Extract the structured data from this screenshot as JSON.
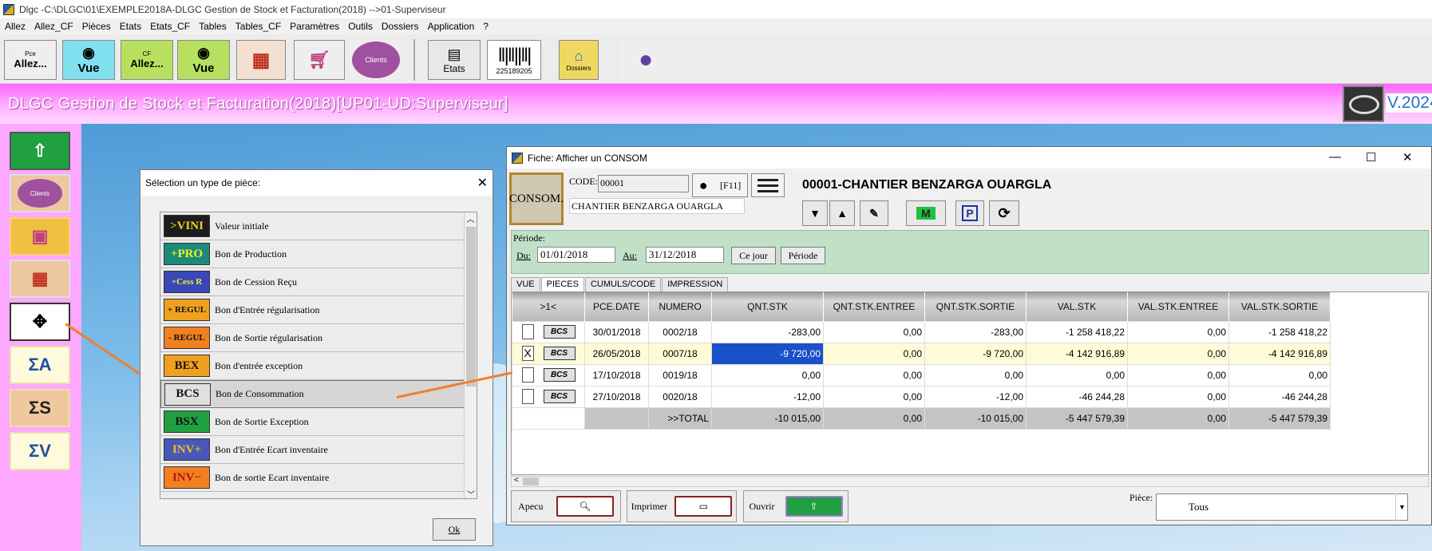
{
  "window": {
    "title": "Dlgc -C:\\DLGC\\01\\EXEMPLE2018A-DLGC Gestion de Stock et Facturation(2018) -->01-Superviseur"
  },
  "menu": [
    "Allez",
    "Allez_CF",
    "Pièces",
    "Etats",
    "Etats_CF",
    "Tables",
    "Tables_CF",
    "Paramètres",
    "Outils",
    "Dossiers",
    "Application",
    "?"
  ],
  "toolbar": {
    "pce_label": "Pce",
    "allez": "Allez...",
    "vue": "Vue",
    "cf_label": "CF",
    "clients": "Clients",
    "etats": "Etats",
    "barcode": "225189205",
    "dossiers": "Dossiers"
  },
  "banner": {
    "text": "DLGC Gestion de Stock et Facturation(2018)[UP01-UD:Superviseur]",
    "version": "V.2024"
  },
  "leftbar": {
    "clients": "Clients",
    "sa": "ΣA",
    "ss": "ΣS",
    "sv": "ΣV"
  },
  "dialog": {
    "title": "Sélection un type de pièce:",
    "ok": "Ok",
    "items": [
      {
        "icon": ">VINI",
        "label": "Valeur initiale",
        "color": "#1c1c1c",
        "fg": "#f0d020"
      },
      {
        "icon": "+PRO",
        "label": "Bon de Production",
        "color": "#1c8a78",
        "fg": "#f0f020"
      },
      {
        "icon": "+Cess R",
        "label": "Bon de Cession Reçu",
        "color": "#3848b8",
        "fg": "#f0f020"
      },
      {
        "icon": "+ REGUL",
        "label": "Bon d'Entrée régularisation",
        "color": "#f0a020",
        "fg": "#111"
      },
      {
        "icon": "- REGUL",
        "label": "Bon de Sortie régularisation",
        "color": "#f08020",
        "fg": "#111"
      },
      {
        "icon": "BEX",
        "label": "Bon d'entrée exception",
        "color": "#f0a020",
        "fg": "#111"
      },
      {
        "icon": "BCS",
        "label": "Bon de Consommation",
        "color": "#e0e0e0",
        "fg": "#111"
      },
      {
        "icon": "BSX",
        "label": "Bon de Sortie Exception",
        "color": "#20a040",
        "fg": "#111"
      },
      {
        "icon": "INV+",
        "label": "Bon d'Entrée Ecart inventaire",
        "color": "#4858b8",
        "fg": "#f0c020"
      },
      {
        "icon": "INV−",
        "label": "Bon de sortie Ecart inventaire",
        "color": "#f08020",
        "fg": "#c01010"
      }
    ]
  },
  "fiche": {
    "title": "Fiche: Afficher un CONSOM",
    "logo": "CONSOM.",
    "code_label": "CODE:",
    "code_value": "00001",
    "name_value": "CHANTIER BENZARGA OUARGLA",
    "f11": "[F11]",
    "heading": "00001-CHANTIER BENZARGA OUARGLA",
    "periode_label": "Période:",
    "du_label": "Du:",
    "du_value": "01/01/2018",
    "au_label": "Au:",
    "au_value": "31/12/2018",
    "ce_jour": "Ce jour",
    "periode_btn": "Période",
    "tabs": [
      "VUE",
      "PIECES",
      "CUMULS/CODE",
      "IMPRESSION"
    ],
    "columns": [
      ">1<",
      "PCE.DATE",
      "NUMERO",
      "QNT.STK",
      "QNT.STK.ENTREE",
      "QNT.STK.SORTIE",
      "VAL.STK",
      "VAL.STK.ENTREE",
      "VAL.STK.SORTIE"
    ],
    "rows": [
      {
        "check": "",
        "icon": "BCS",
        "date": "30/01/2018",
        "num": "0002/18",
        "q": "-283,00",
        "qe": "0,00",
        "qs": "-283,00",
        "v": "-1 258 418,22",
        "ve": "0,00",
        "vs": "-1 258 418,22"
      },
      {
        "check": "X",
        "icon": "BCS",
        "date": "26/05/2018",
        "num": "0007/18",
        "q": "-9 720,00",
        "qe": "0,00",
        "qs": "-9 720,00",
        "v": "-4 142 916,89",
        "ve": "0,00",
        "vs": "-4 142 916,89"
      },
      {
        "check": "",
        "icon": "BCS",
        "date": "17/10/2018",
        "num": "0019/18",
        "q": "0,00",
        "qe": "0,00",
        "qs": "0,00",
        "v": "0,00",
        "ve": "0,00",
        "vs": "0,00"
      },
      {
        "check": "",
        "icon": "BCS",
        "date": "27/10/2018",
        "num": "0020/18",
        "q": "-12,00",
        "qe": "0,00",
        "qs": "-12,00",
        "v": "-46 244,28",
        "ve": "0,00",
        "vs": "-46 244,28"
      }
    ],
    "total": {
      "label": ">>TOTAL",
      "q": "-10 015,00",
      "qe": "0,00",
      "qs": "-10 015,00",
      "v": "-5 447 579,39",
      "ve": "0,00",
      "vs": "-5 447 579,39"
    },
    "apecu": "Apecu",
    "imprimer": "Imprimer",
    "ouvrir": "Ouvrir",
    "piece_label": "Pièce:",
    "piece_value": "Tous"
  }
}
